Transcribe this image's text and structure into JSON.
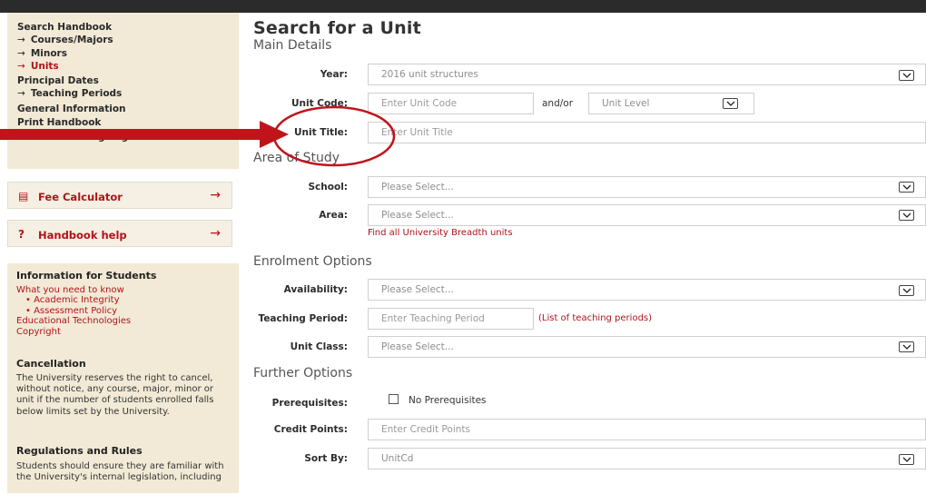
{
  "sidebar": {
    "nav": [
      {
        "label": "Search Handbook",
        "arrow": false,
        "red": false
      },
      {
        "label": "Courses/Majors",
        "arrow": true,
        "red": false
      },
      {
        "label": "Minors",
        "arrow": true,
        "red": false
      },
      {
        "label": "Units",
        "arrow": true,
        "red": true
      },
      {
        "label": "Principal Dates",
        "arrow": false,
        "red": false
      },
      {
        "label": "Teaching Periods",
        "arrow": true,
        "red": false
      },
      {
        "label": "General Information",
        "arrow": false,
        "red": false
      },
      {
        "label": "Print Handbook",
        "arrow": false,
        "red": false
      },
      {
        "label": "Course Planning Page",
        "arrow": false,
        "red": false
      }
    ],
    "fee_calculator": "Fee Calculator",
    "handbook_help": "Handbook help",
    "info_heading": "Information for Students",
    "info_links": {
      "need_to_know": "What you need to know",
      "academic_integrity": "• Academic Integrity",
      "assessment_policy": "• Assessment Policy",
      "edu_tech": "Educational Technologies",
      "copyright": "Copyright"
    },
    "cancellation_heading": "Cancellation",
    "cancellation_text": "The University reserves the right to cancel, without notice, any course, major, minor or unit if the number of students enrolled falls below limits set by the University.",
    "regulations_heading": "Regulations and Rules",
    "regulations_text": "Students should ensure they are familiar with the University's internal legislation, including"
  },
  "main": {
    "title": "Search for a Unit",
    "sections": {
      "main_details": "Main Details",
      "area_of_study": "Area of Study",
      "enrolment_options": "Enrolment Options",
      "further_options": "Further Options"
    },
    "labels": {
      "year": "Year:",
      "unit_code": "Unit Code:",
      "unit_title": "Unit Title:",
      "school": "School:",
      "area": "Area:",
      "availability": "Availability:",
      "teaching_period": "Teaching Period:",
      "unit_class": "Unit Class:",
      "prerequisites": "Prerequisites:",
      "credit_points": "Credit Points:",
      "sort_by": "Sort By:"
    },
    "values": {
      "year": "2016 unit structures",
      "unit_code_placeholder": "Enter Unit Code",
      "and_or": "and/or",
      "unit_level": "Unit Level",
      "unit_title_placeholder": "Enter Unit Title",
      "school": "Please Select...",
      "area": "Please Select...",
      "breadth_link": "Find all University Breadth units",
      "availability": "Please Select...",
      "teaching_period_placeholder": "Enter Teaching Period",
      "teaching_period_link": "(List of teaching periods)",
      "unit_class": "Please Select...",
      "no_prerequisites": "No Prerequisites",
      "credit_points_placeholder": "Enter Credit Points",
      "sort_by": "UnitCd"
    }
  },
  "colors": {
    "accent_red": "#b3121a",
    "sidebar_bg": "#f2ead6",
    "annotation_red": "#c0141b"
  }
}
